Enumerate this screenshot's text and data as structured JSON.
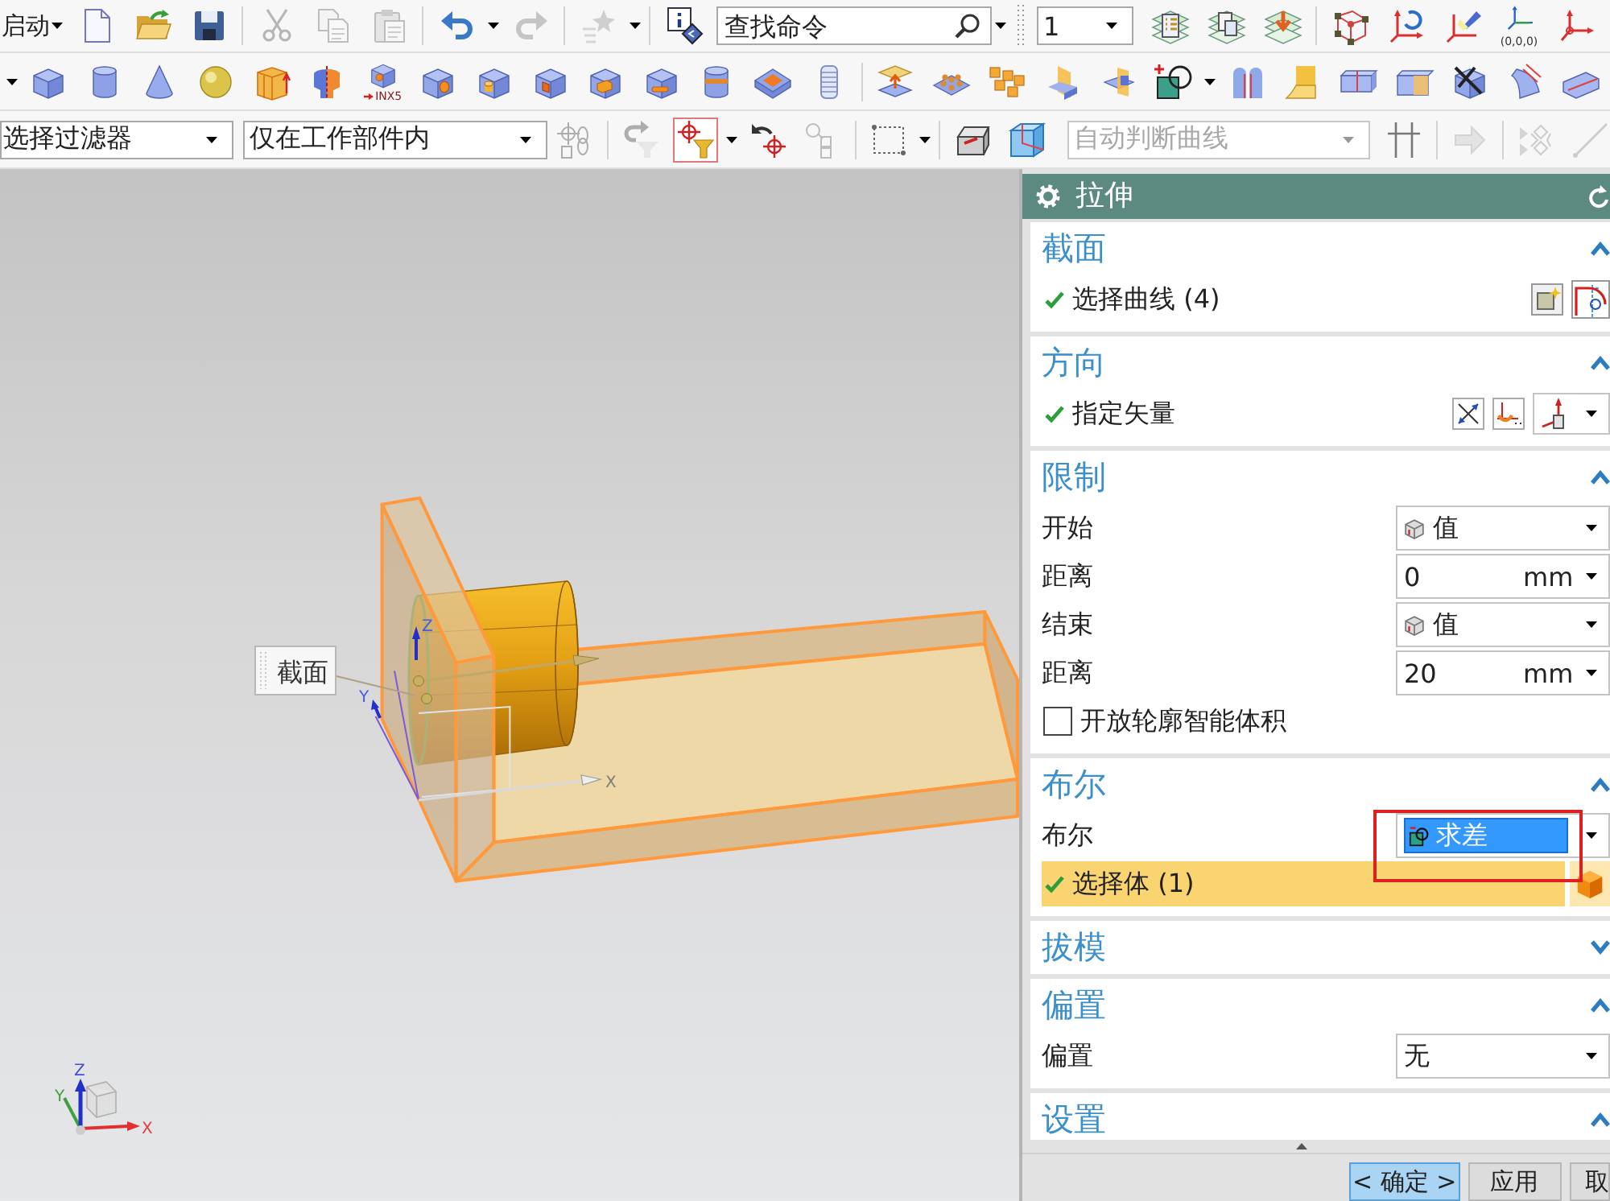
{
  "standard_toolbar": {
    "start_menu": "启动",
    "tools": [
      {
        "disabled": false
      },
      {
        "disabled": false
      },
      {
        "disabled": false
      },
      {
        "disabled": true
      },
      {
        "disabled": true
      },
      {
        "disabled": true
      },
      {
        "disabled": false
      },
      {
        "disabled": true
      },
      {
        "disabled": true
      },
      {
        "disabled": false
      }
    ],
    "search": {
      "placeholder": "查找命令"
    },
    "layer": {
      "value": "1"
    },
    "view_tools": [
      {
        "disabled": false
      },
      {
        "disabled": false
      },
      {
        "disabled": false
      },
      {
        "disabled": false
      },
      {
        "disabled": false
      },
      {
        "disabled": false
      },
      {
        "disabled": false,
        "caption": "(0,0,0)"
      },
      {
        "disabled": false
      }
    ]
  },
  "feature_toolbar": {
    "tools": [
      {
        "disabled": false
      },
      {
        "disabled": false
      },
      {
        "disabled": false
      },
      {
        "disabled": false
      },
      {
        "disabled": false
      },
      {
        "disabled": false
      },
      {
        "disabled": false,
        "caption": "INX5"
      },
      {
        "disabled": false
      },
      {
        "disabled": false
      },
      {
        "disabled": false
      },
      {
        "disabled": false
      },
      {
        "disabled": false
      },
      {
        "disabled": false
      },
      {
        "disabled": false
      },
      {
        "disabled": false
      },
      {
        "disabled": false
      },
      {
        "disabled": false
      },
      {
        "disabled": false
      },
      {
        "disabled": false
      },
      {
        "disabled": false
      },
      {
        "disabled": false
      },
      {
        "disabled": false
      },
      {
        "disabled": false
      },
      {
        "disabled": false
      },
      {
        "disabled": false
      },
      {
        "disabled": false
      },
      {
        "disabled": false
      },
      {
        "disabled": false
      }
    ]
  },
  "selection_bar": {
    "type_filter": "选择过滤器",
    "scope_filter": "仅在工作部件内",
    "tools": [
      {
        "disabled": true,
        "on": false
      },
      {
        "disabled": true,
        "on": false
      },
      {
        "disabled": false,
        "on": true
      },
      {
        "disabled": false,
        "on": false
      },
      {
        "disabled": true,
        "on": false
      },
      {
        "disabled": false,
        "on": false
      },
      {
        "disabled": false,
        "on": false
      },
      {
        "disabled": false,
        "on": false
      }
    ],
    "curve_rule": {
      "value": "自动判断曲线",
      "disabled": true
    },
    "more_tools": [
      {
        "disabled": false
      },
      {
        "disabled": true
      },
      {
        "disabled": true
      },
      {
        "disabled": true
      }
    ]
  },
  "viewport": {
    "section_label": "截面",
    "csys_labels": [
      "Z",
      "Y",
      "X"
    ],
    "triad_labels": [
      "Z",
      "Y",
      "X"
    ]
  },
  "dialog": {
    "title": "拉伸",
    "groups": [
      {
        "title": "截面",
        "expanded": true,
        "rows": [
          {
            "kind": "curve-selection",
            "label": "选择曲线 (4)",
            "done": true,
            "active": false
          }
        ]
      },
      {
        "title": "方向",
        "expanded": true,
        "rows": [
          {
            "kind": "vector",
            "label": "指定矢量",
            "done": true,
            "active": false
          }
        ]
      },
      {
        "title": "限制",
        "expanded": true,
        "rows": [
          {
            "kind": "value-option",
            "label": "开始",
            "value": "值"
          },
          {
            "kind": "distance",
            "label": "距离",
            "value": "0",
            "unit": "mm"
          },
          {
            "kind": "value-option",
            "label": "结束",
            "value": "值"
          },
          {
            "kind": "distance",
            "label": "距离",
            "value": "20",
            "unit": "mm"
          },
          {
            "kind": "checkbox",
            "label": "开放轮廓智能体积",
            "checked": false
          }
        ]
      },
      {
        "title": "布尔",
        "expanded": true,
        "rows": [
          {
            "kind": "boolean-option",
            "label": "布尔",
            "value": "求差",
            "highlighted": true,
            "marked": true
          },
          {
            "kind": "body-selection",
            "label": "选择体 (1)",
            "done": true,
            "active": true
          }
        ]
      },
      {
        "title": "拔模",
        "expanded": false
      },
      {
        "title": "偏置",
        "expanded": true,
        "rows": [
          {
            "kind": "option",
            "label": "偏置",
            "value": "无"
          }
        ]
      },
      {
        "title": "设置",
        "expanded": true
      }
    ],
    "buttons": [
      {
        "label": "< 确定 >",
        "default": true
      },
      {
        "label": "应用",
        "default": false
      },
      {
        "label": "取",
        "default": false
      }
    ]
  }
}
